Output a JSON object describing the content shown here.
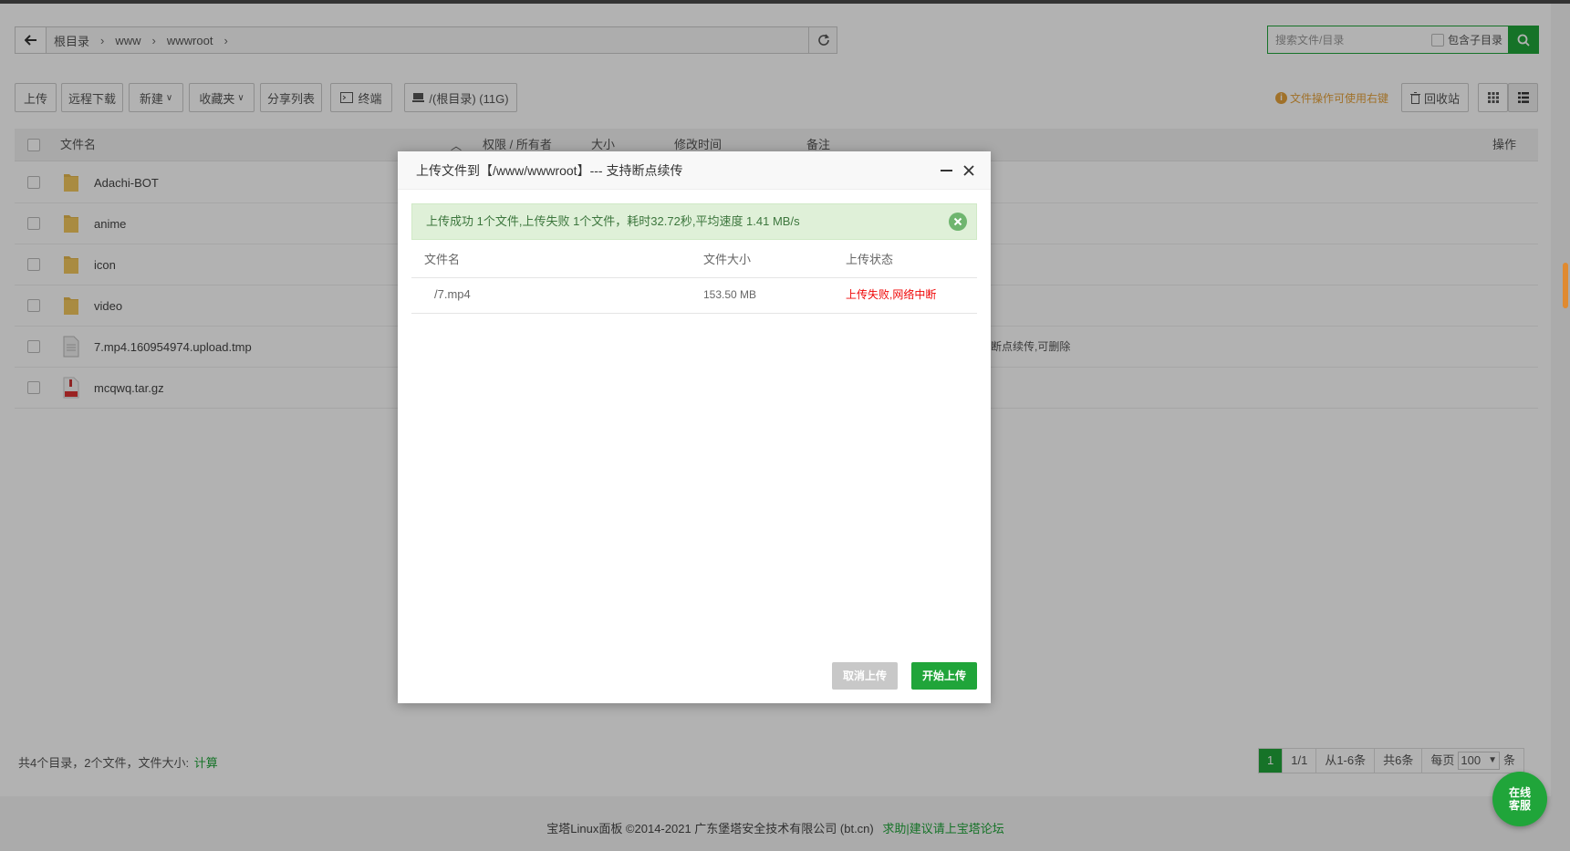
{
  "breadcrumb": {
    "items": [
      "根目录",
      "www",
      "wwwroot"
    ]
  },
  "search": {
    "placeholder": "搜索文件/目录",
    "include_subdir_label": "包含子目录"
  },
  "toolbar": {
    "upload": "上传",
    "remote_download": "远程下载",
    "new": "新建",
    "favorites": "收藏夹",
    "share_list": "分享列表",
    "terminal": "终端",
    "disk": "/(根目录) (11G)",
    "tip": "文件操作可使用右键",
    "recycle": "回收站"
  },
  "table": {
    "headers": {
      "name": "文件名",
      "perm": "权限 / 所有者",
      "size": "大小",
      "mtime": "修改时间",
      "note": "备注",
      "ops": "操作"
    },
    "rows": [
      {
        "name": "Adachi-BOT",
        "type": "folder",
        "note": ""
      },
      {
        "name": "anime",
        "type": "folder",
        "note": ""
      },
      {
        "name": "icon",
        "type": "folder",
        "note": ""
      },
      {
        "name": "video",
        "type": "folder",
        "note": ""
      },
      {
        "name": "7.mp4.160954974.upload.tmp",
        "type": "file",
        "note": "断点续传,可删除"
      },
      {
        "name": "mcqwq.tar.gz",
        "type": "archive",
        "note": ""
      }
    ]
  },
  "footer": {
    "summary": "共4个目录，2个文件，文件大小:",
    "calc_link": "计算",
    "pager": {
      "current": "1",
      "pages": "1/1",
      "range": "从1-6条",
      "total": "共6条",
      "per_page_label": "每页",
      "per_page_value": "100",
      "unit": "条"
    }
  },
  "copyright": {
    "text": "宝塔Linux面板 ©2014-2021 广东堡塔安全技术有限公司 (bt.cn)",
    "link": "求助|建议请上宝塔论坛"
  },
  "kefu": {
    "line1": "在线",
    "line2": "客服"
  },
  "modal": {
    "title": "上传文件到【/www/wwwroot】--- 支持断点续传",
    "alert": "上传成功 1个文件,上传失败 1个文件，耗时32.72秒,平均速度 1.41 MB/s",
    "headers": {
      "name": "文件名",
      "size": "文件大小",
      "status": "上传状态"
    },
    "files": [
      {
        "name": "/7.mp4",
        "size": "153.50 MB",
        "status": "上传失败,网络中断"
      }
    ],
    "cancel_label": "取消上传",
    "start_label": "开始上传"
  },
  "colors": {
    "brand": "#20a53a",
    "error": "#ef0808",
    "warning": "#e6a23c"
  }
}
